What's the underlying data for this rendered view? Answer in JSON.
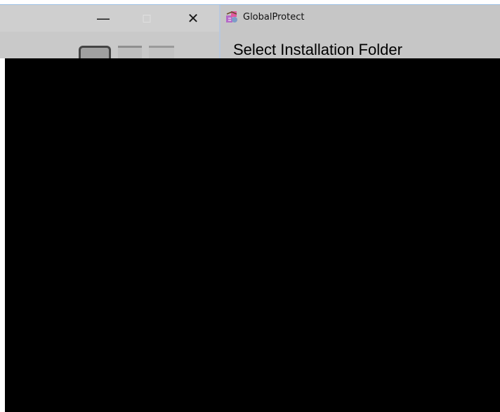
{
  "background_window": {
    "buttons": {
      "minimize": "—",
      "maximize": "□",
      "close": "✕"
    }
  },
  "installer_window": {
    "title": "GlobalProtect",
    "heading": "Select Installation Folder",
    "icon": "globalprotect-icon"
  },
  "colors": {
    "titlebar": "#c6c6c6",
    "redaction": "#000000",
    "accent_border": "#9ec1e6"
  }
}
